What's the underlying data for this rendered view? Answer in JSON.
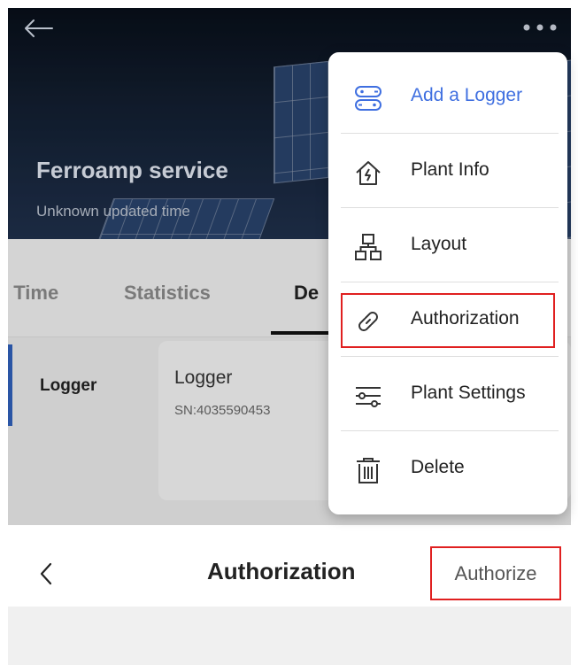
{
  "header": {
    "plant_name": "Ferroamp service",
    "updated_text": "Unknown updated time",
    "icons": {
      "back": "back-arrow-icon",
      "more": "more-dots-icon"
    }
  },
  "tabs": [
    {
      "label": "l Time"
    },
    {
      "label": "Statistics"
    },
    {
      "label": "De",
      "active": true
    }
  ],
  "content": {
    "sidebar_label": "Logger",
    "device": {
      "name": "Logger",
      "sn": "SN:4035590453"
    }
  },
  "menu": {
    "items": [
      {
        "label": "Add a Logger",
        "icon": "add-logger-icon",
        "accent": true
      },
      {
        "label": "Plant Info",
        "icon": "plant-info-icon"
      },
      {
        "label": "Layout",
        "icon": "layout-icon"
      },
      {
        "label": "Authorization",
        "icon": "link-icon",
        "highlighted": true
      },
      {
        "label": "Plant Settings",
        "icon": "sliders-icon"
      },
      {
        "label": "Delete",
        "icon": "trash-icon"
      }
    ]
  },
  "bottom": {
    "title": "Authorization",
    "action_label": "Authorize",
    "back_icon": "chevron-left-icon"
  },
  "colors": {
    "accent": "#3f6fe0",
    "highlight": "#e02020",
    "hero_dark": "#0c1523"
  }
}
